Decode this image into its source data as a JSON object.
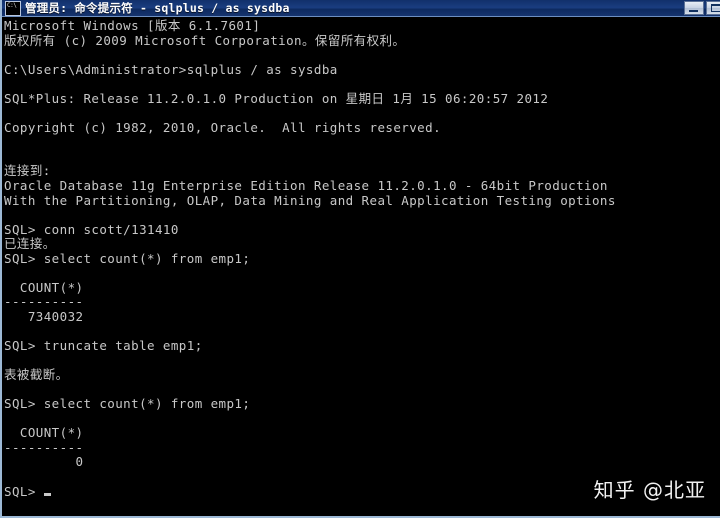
{
  "window": {
    "title": "管理员: 命令提示符 - sqlplus  / as sysdba",
    "icon": "console-icon",
    "buttons": {
      "minimize": "minimize-button",
      "maximize": "maximize-button"
    }
  },
  "console": {
    "lines": [
      "Microsoft Windows [版本 6.1.7601]",
      "版权所有 (c) 2009 Microsoft Corporation。保留所有权利。",
      "",
      "C:\\Users\\Administrator>sqlplus / as sysdba",
      "",
      "SQL*Plus: Release 11.2.0.1.0 Production on 星期日 1月 15 06:20:57 2012",
      "",
      "Copyright (c) 1982, 2010, Oracle.  All rights reserved.",
      "",
      "",
      "连接到:",
      "Oracle Database 11g Enterprise Edition Release 11.2.0.1.0 - 64bit Production",
      "With the Partitioning, OLAP, Data Mining and Real Application Testing options",
      "",
      "SQL> conn scott/131410",
      "已连接。",
      "SQL> select count(*) from emp1;",
      "",
      "  COUNT(*)",
      "----------",
      "   7340032",
      "",
      "SQL> truncate table emp1;",
      "",
      "表被截断。",
      "",
      "SQL> select count(*) from emp1;",
      "",
      "  COUNT(*)",
      "----------",
      "         0",
      "",
      "SQL> "
    ],
    "prompt_symbol": "SQL>",
    "cursor": "block-cursor"
  },
  "watermark": {
    "text": "知乎 @北亚"
  },
  "colors": {
    "console_background": "#000000",
    "console_text": "#c8c8c8",
    "titlebar_background": "#11306b",
    "titlebar_text": "#ffffff",
    "window_border": "#9db9d6"
  }
}
